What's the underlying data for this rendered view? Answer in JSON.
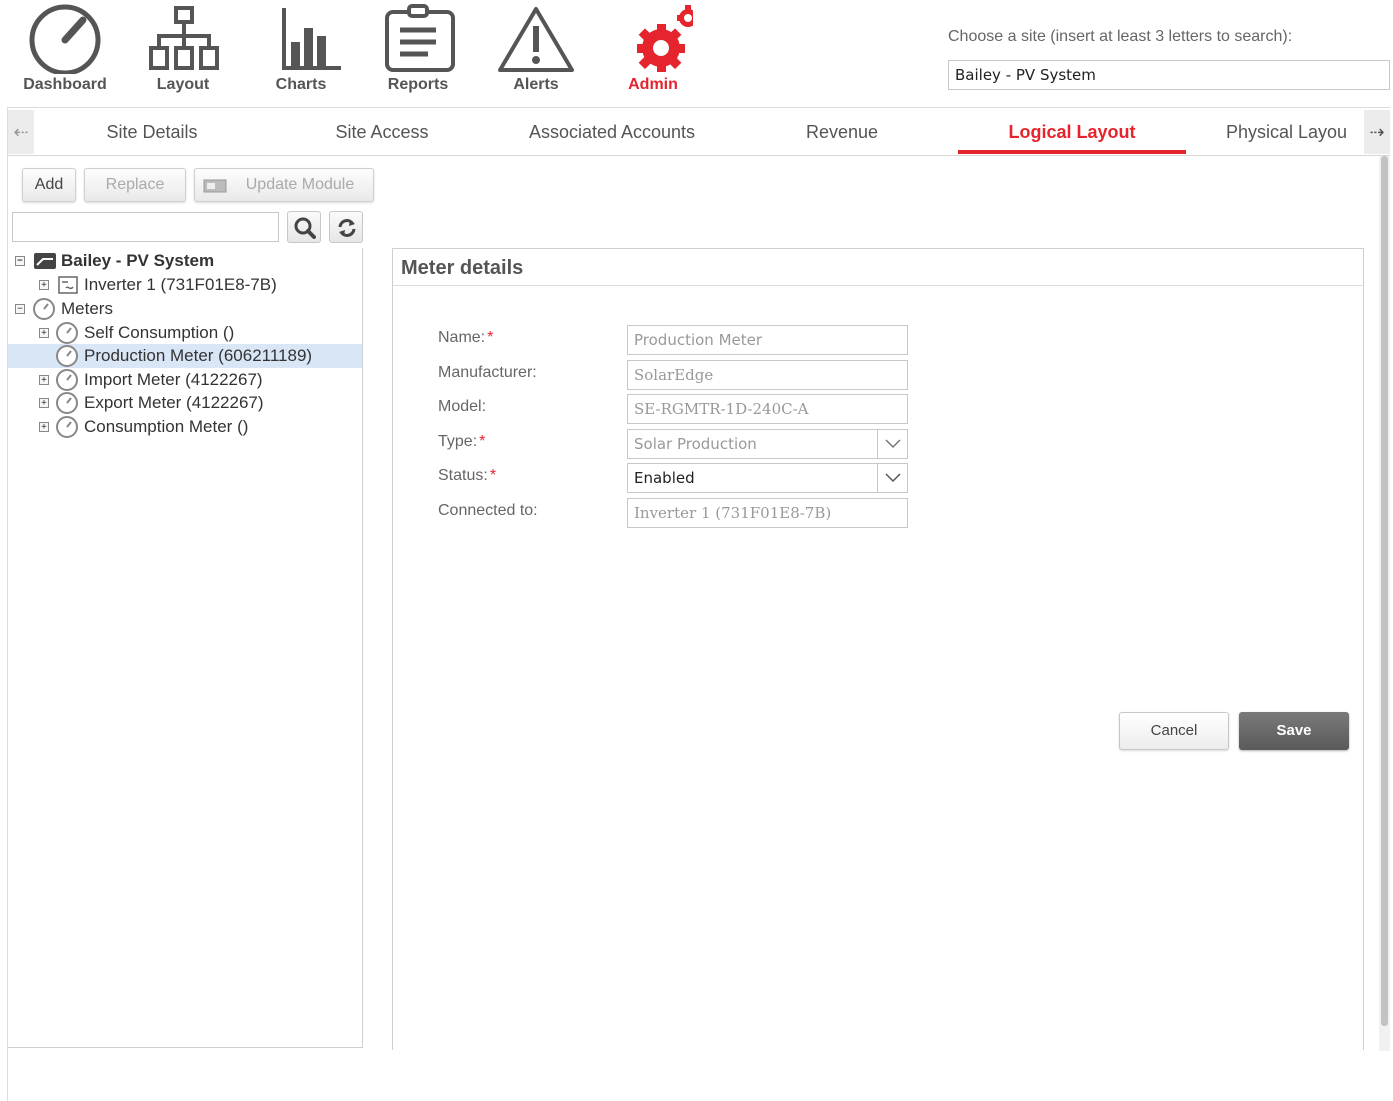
{
  "nav": {
    "items": [
      {
        "label": "Dashboard",
        "icon": "dashboard-gauge-icon"
      },
      {
        "label": "Layout",
        "icon": "layout-hierarchy-icon"
      },
      {
        "label": "Charts",
        "icon": "bar-chart-icon"
      },
      {
        "label": "Reports",
        "icon": "clipboard-report-icon"
      },
      {
        "label": "Alerts",
        "icon": "warning-triangle-icon"
      },
      {
        "label": "Admin",
        "icon": "gears-icon",
        "active": true
      }
    ]
  },
  "site_chooser": {
    "hint": "Choose a site (insert at least 3 letters to search):",
    "value": "Bailey - PV System"
  },
  "tabs": [
    {
      "label": "Site Details"
    },
    {
      "label": "Site Access"
    },
    {
      "label": "Associated Accounts"
    },
    {
      "label": "Revenue"
    },
    {
      "label": "Logical Layout",
      "active": true
    },
    {
      "label": "Physical Layou"
    }
  ],
  "toolbar": {
    "add": "Add",
    "replace": "Replace",
    "update_module": "Update Module",
    "search_value": ""
  },
  "tree": {
    "root": "Bailey - PV System",
    "inverter": "Inverter 1 (731F01E8-7B)",
    "meters": "Meters",
    "meter_items": [
      "Self Consumption ()",
      "Production Meter (606211189)",
      "Import Meter (4122267)",
      "Export Meter (4122267)",
      "Consumption Meter ()"
    ],
    "selected": "Production Meter (606211189)"
  },
  "details": {
    "title": "Meter details",
    "fields": [
      {
        "label": "Name:",
        "required": true,
        "value": "Production Meter"
      },
      {
        "label": "Manufacturer:",
        "required": false,
        "value": "SolarEdge"
      },
      {
        "label": "Model:",
        "required": false,
        "value": "SE-RGMTR-1D-240C-A"
      },
      {
        "label": "Type:",
        "required": true,
        "value": "Solar Production"
      },
      {
        "label": "Status:",
        "required": true,
        "value": "Enabled"
      },
      {
        "label": "Connected to:",
        "required": false,
        "value": "Inverter 1 (731F01E8-7B)"
      }
    ],
    "required_mark": "*",
    "cancel": "Cancel",
    "save": "Save"
  },
  "colors": {
    "accent": "#e5242e",
    "selected_row": "#d9e6f6",
    "save_button": "#666666"
  }
}
